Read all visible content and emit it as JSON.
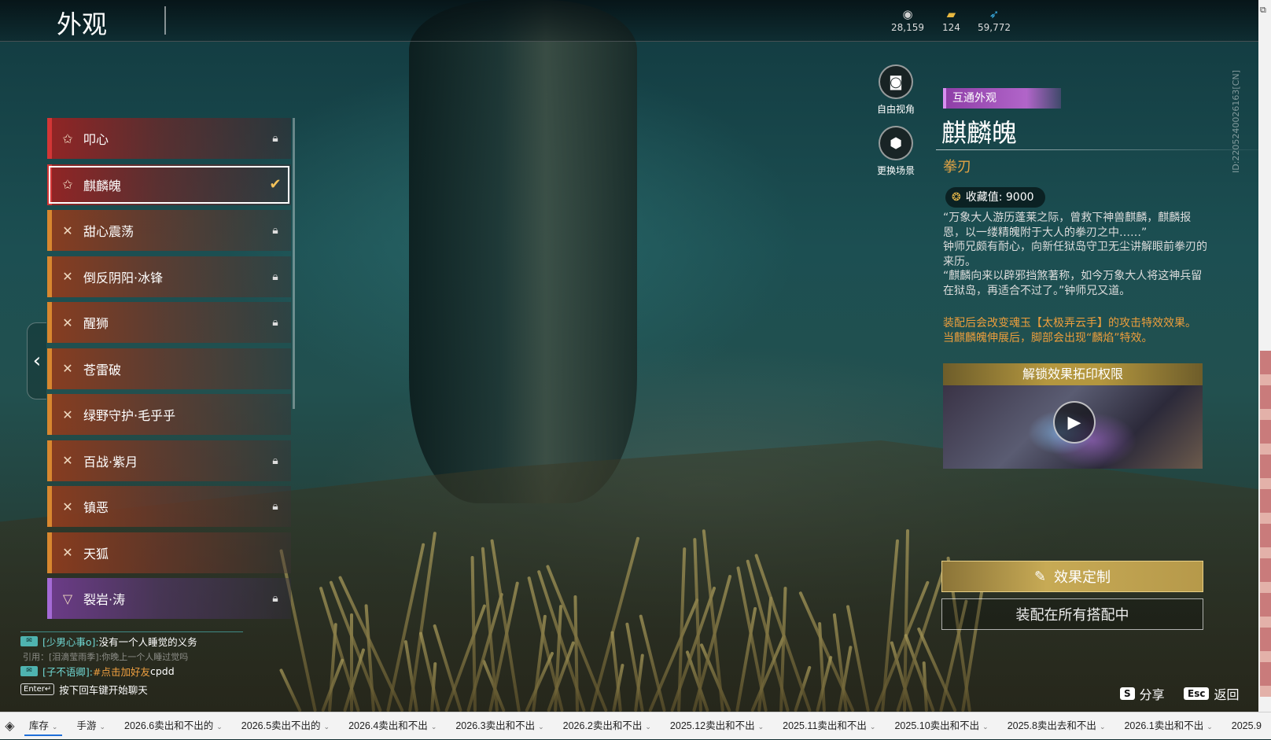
{
  "header": {
    "title": "外观",
    "currencies": [
      {
        "icon": "coin-icon",
        "value": "28,159"
      },
      {
        "icon": "ticket-icon",
        "value": "124"
      },
      {
        "icon": "feather-icon",
        "value": "59,772"
      }
    ]
  },
  "side_id": "ID:2205240026163[CN]",
  "list": {
    "items": [
      {
        "label": "叩心",
        "rarity": "red",
        "locked": true,
        "selected": false
      },
      {
        "label": "麒麟魄",
        "rarity": "red",
        "locked": false,
        "selected": true
      },
      {
        "label": "甜心震荡",
        "rarity": "orange",
        "locked": true,
        "selected": false
      },
      {
        "label": "倒反阴阳·冰锋",
        "rarity": "orange",
        "locked": true,
        "selected": false
      },
      {
        "label": "醒狮",
        "rarity": "orange",
        "locked": true,
        "selected": false
      },
      {
        "label": "苍雷破",
        "rarity": "orange",
        "locked": false,
        "selected": false
      },
      {
        "label": "绿野守护·毛乎乎",
        "rarity": "orange",
        "locked": false,
        "selected": false
      },
      {
        "label": "百战·紫月",
        "rarity": "orange",
        "locked": true,
        "selected": false
      },
      {
        "label": "镇恶",
        "rarity": "orange",
        "locked": true,
        "selected": false
      },
      {
        "label": "天狐",
        "rarity": "orange",
        "locked": false,
        "selected": false
      },
      {
        "label": "裂岩·涛",
        "rarity": "purple",
        "locked": true,
        "selected": false
      }
    ]
  },
  "camera": {
    "free_view": "自由视角",
    "change_scene": "更换场景"
  },
  "detail": {
    "tag": "互通外观",
    "name": "麒麟魄",
    "weapon_type": "拳刃",
    "collect_label": "收藏值: 9000",
    "description": "“万象大人游历蓬莱之际，曾救下神兽麒麟，麒麟报恩，以一缕精魄附于大人的拳刃之中……”\n钟师兄颇有耐心，向新任狱岛守卫无尘讲解眼前拳刃的来历。\n“麒麟向来以辟邪挡煞著称，如今万象大人将这神兵留在狱岛，再适合不过了。”钟师兄又道。",
    "effect_text": "装配后会改变魂玉【太极弄云手】的攻击特效效果。\n当麒麟魄伸展后，脚部会出现“麟焰”特效。",
    "unlock_title": "解锁效果拓印权限",
    "custom_button": "效果定制",
    "equip_button": "装配在所有搭配中"
  },
  "chat": {
    "lines": [
      {
        "user": "[少男心事o]:",
        "message": "没有一个人睡觉的义务"
      },
      {
        "quote": "引用：[泪滴莹雨季]:你晚上一个人睡过觉吗"
      },
      {
        "user": "[子不语卿]:",
        "link": "#点击加好友",
        "message": " cpdd"
      }
    ],
    "enter_key": "Enter↵",
    "enter_hint": "按下回车键开始聊天"
  },
  "hints": {
    "share_key": "S",
    "share_label": "分享",
    "back_key": "Esc",
    "back_label": "返回"
  },
  "taskbar": {
    "tabs": [
      "库存",
      "手游",
      "2026.6卖出和不出的",
      "2026.5卖出不出的",
      "2026.4卖出和不出",
      "2026.3卖出和不出",
      "2026.2卖出和不出",
      "2025.12卖出和不出",
      "2025.11卖出和不出",
      "2025.10卖出和不出",
      "2025.8卖出去和不出",
      "2026.1卖出和不出",
      "2025.9"
    ]
  }
}
